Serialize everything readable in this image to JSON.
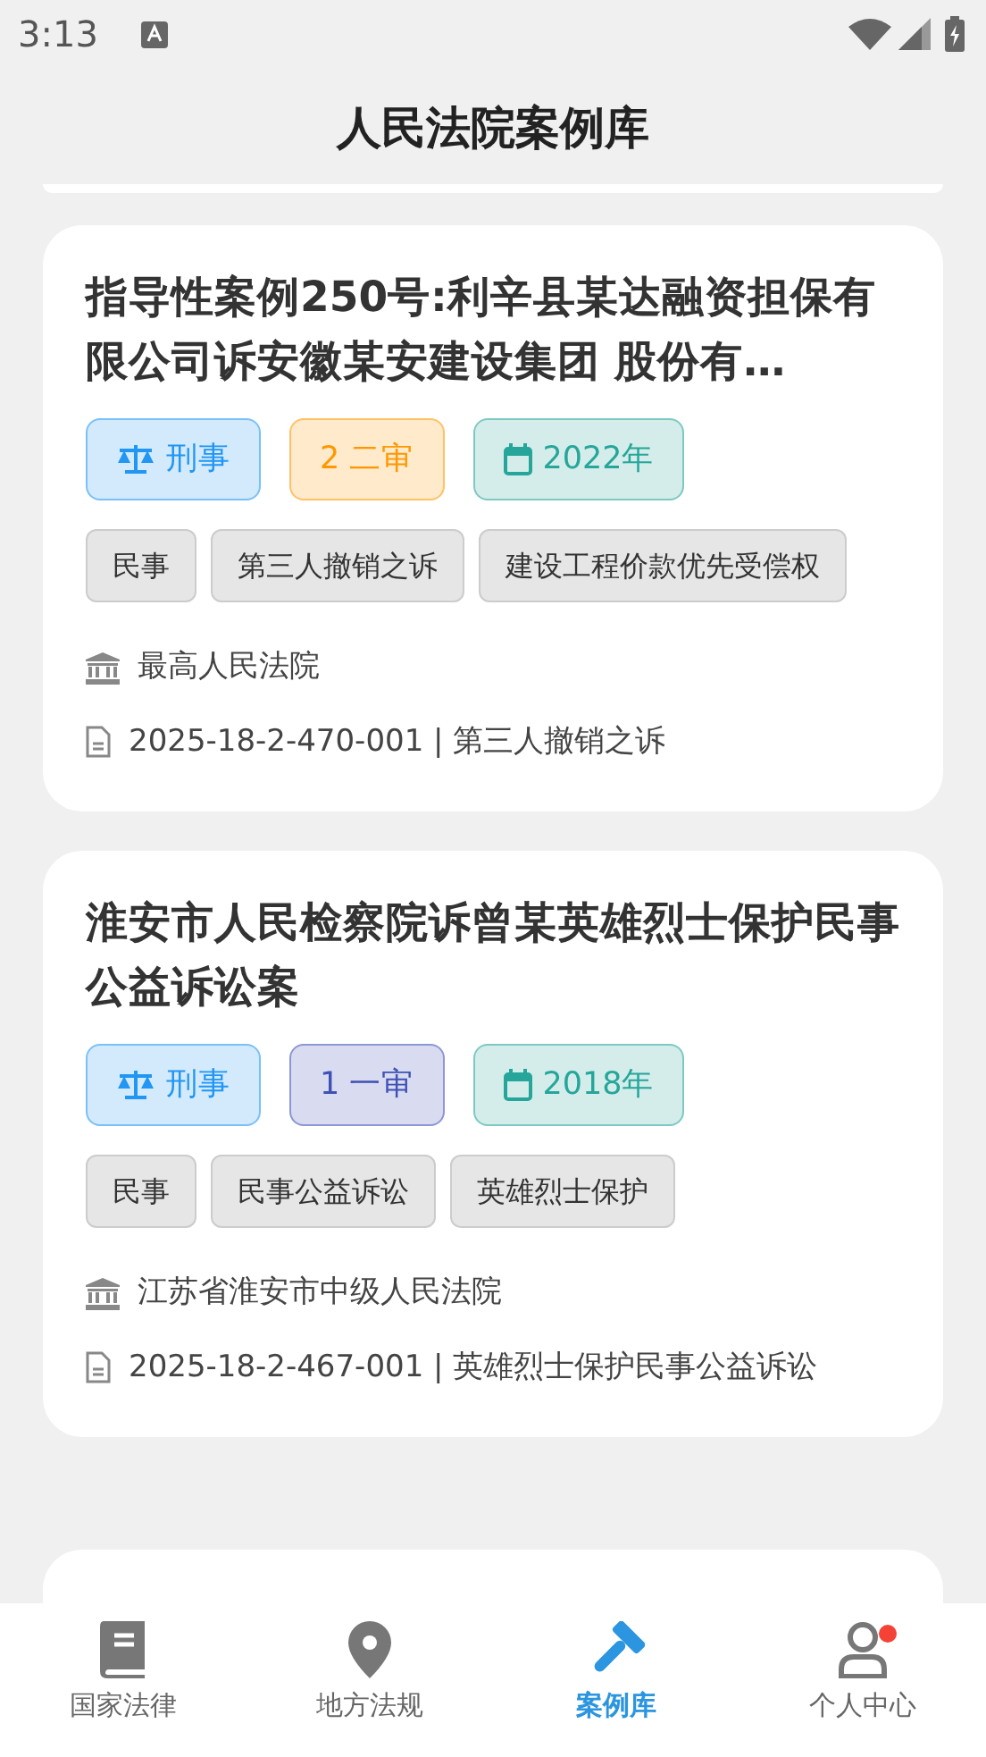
{
  "status_bar": {
    "time": "3:13"
  },
  "header": {
    "title": "人民法院案例库"
  },
  "cases": [
    {
      "title": "指导性案例250号:利辛县某达融资担保有限公司诉安徽某安建设集团 股份有…",
      "badges": [
        {
          "kind": "type",
          "text": "刑事",
          "color": "#2196f3"
        },
        {
          "kind": "trial",
          "text": "2 二审",
          "color": "#ff9800"
        },
        {
          "kind": "year",
          "text": "2022年",
          "color": "#26a69a"
        }
      ],
      "tags": [
        "民事",
        "第三人撤销之诉",
        "建设工程价款优先受偿权"
      ],
      "court": "最高人民法院",
      "number": "2025-18-2-470-001 | 第三人撤销之诉"
    },
    {
      "title": "淮安市人民检察院诉曾某英雄烈士保护民事公益诉讼案",
      "badges": [
        {
          "kind": "type",
          "text": "刑事",
          "color": "#2196f3"
        },
        {
          "kind": "trial",
          "text": "1 一审",
          "color": "#3f51b5"
        },
        {
          "kind": "year",
          "text": "2018年",
          "color": "#26a69a"
        }
      ],
      "tags": [
        "民事",
        "民事公益诉讼",
        "英雄烈士保护"
      ],
      "court": "江苏省淮安市中级人民法院",
      "number": "2025-18-2-467-001 | 英雄烈士保护民事公益诉讼"
    }
  ],
  "bottom_nav": [
    {
      "label": "国家法律",
      "selected": false,
      "dot": false
    },
    {
      "label": "地方法规",
      "selected": false,
      "dot": false
    },
    {
      "label": "案例库",
      "selected": true,
      "dot": false
    },
    {
      "label": "个人中心",
      "selected": false,
      "dot": true
    }
  ]
}
